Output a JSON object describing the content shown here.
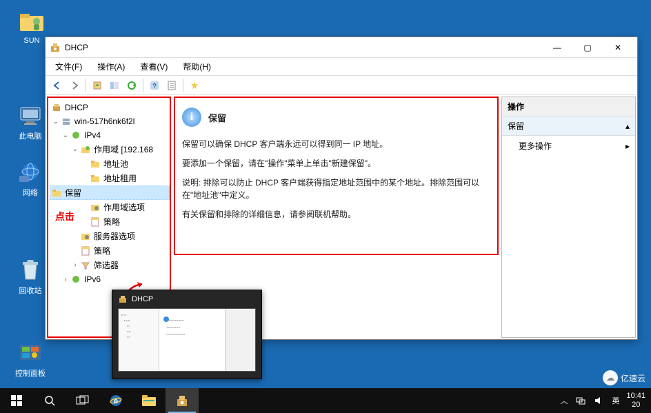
{
  "desktop": {
    "icons": {
      "sun": "SUN",
      "pc": "此电脑",
      "net": "网络",
      "bin": "回收站",
      "cpl": "控制面板"
    }
  },
  "window": {
    "title": "DHCP",
    "menu": {
      "file": "文件(F)",
      "action": "操作(A)",
      "view": "查看(V)",
      "help": "帮助(H)"
    },
    "winbtn": {
      "min": "—",
      "max": "▢",
      "close": "✕"
    }
  },
  "tree": {
    "root": "DHCP",
    "server": "win-517h6nk6f2l",
    "ipv4": "IPv4",
    "scope": "作用域 [192.168",
    "pool": "地址池",
    "leases": "地址租用",
    "reservations": "保留",
    "scope_options": "作用域选项",
    "policies": "策略",
    "server_options": "服务器选项",
    "server_policies": "策略",
    "filters": "筛选器",
    "ipv6": "IPv6"
  },
  "annotation": {
    "click": "点击"
  },
  "content": {
    "title": "保留",
    "p1": "保留可以确保 DHCP 客户端永远可以得到同一 IP 地址。",
    "p2": "要添加一个保留，请在\"操作\"菜单上单击\"新建保留\"。",
    "p3": "说明: 排除可以防止 DHCP 客户端获得指定地址范围中的某个地址。排除范围可以在\"地址池\"中定义。",
    "p4": "有关保留和排除的详细信息，请参阅联机帮助。"
  },
  "actions": {
    "header": "操作",
    "sub": "保留",
    "more": "更多操作"
  },
  "thumb": {
    "title": "DHCP"
  },
  "tray": {
    "ime": "英",
    "time": "10:41",
    "date": "20"
  },
  "watermark": {
    "text": "亿速云"
  }
}
